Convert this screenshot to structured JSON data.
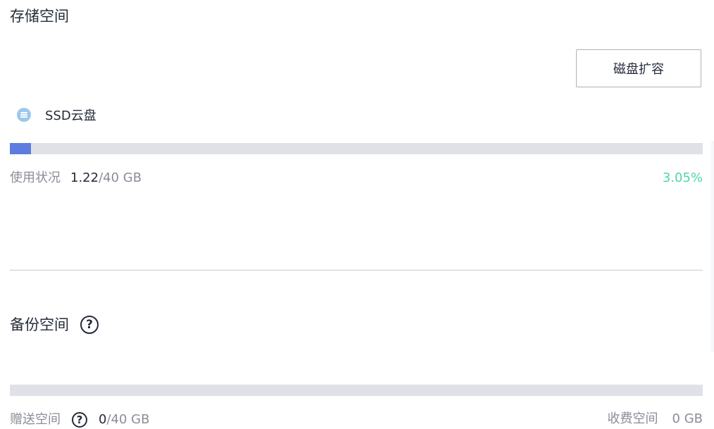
{
  "storage": {
    "title": "存储空间",
    "expand_button": "磁盘扩容",
    "disk": {
      "icon": "disk-icon",
      "name": "SSD云盘"
    },
    "usage": {
      "label": "使用状况",
      "used": "1.22",
      "total": "/40 GB",
      "percent": "3.05%",
      "fill_fraction": 0.0305
    }
  },
  "backup": {
    "title": "备份空间",
    "help_icon": "question-circle-icon",
    "gift": {
      "label": "赠送空间",
      "used": "0",
      "total": "/40 GB",
      "fill_fraction": 0
    },
    "paid": {
      "label": "收费空间",
      "value": "0 GB"
    }
  },
  "colors": {
    "progress_fill": "#5e7ce0",
    "progress_track": "#dfe1e6",
    "percent_text": "#50d4ab",
    "muted_text": "#8a8e99"
  }
}
